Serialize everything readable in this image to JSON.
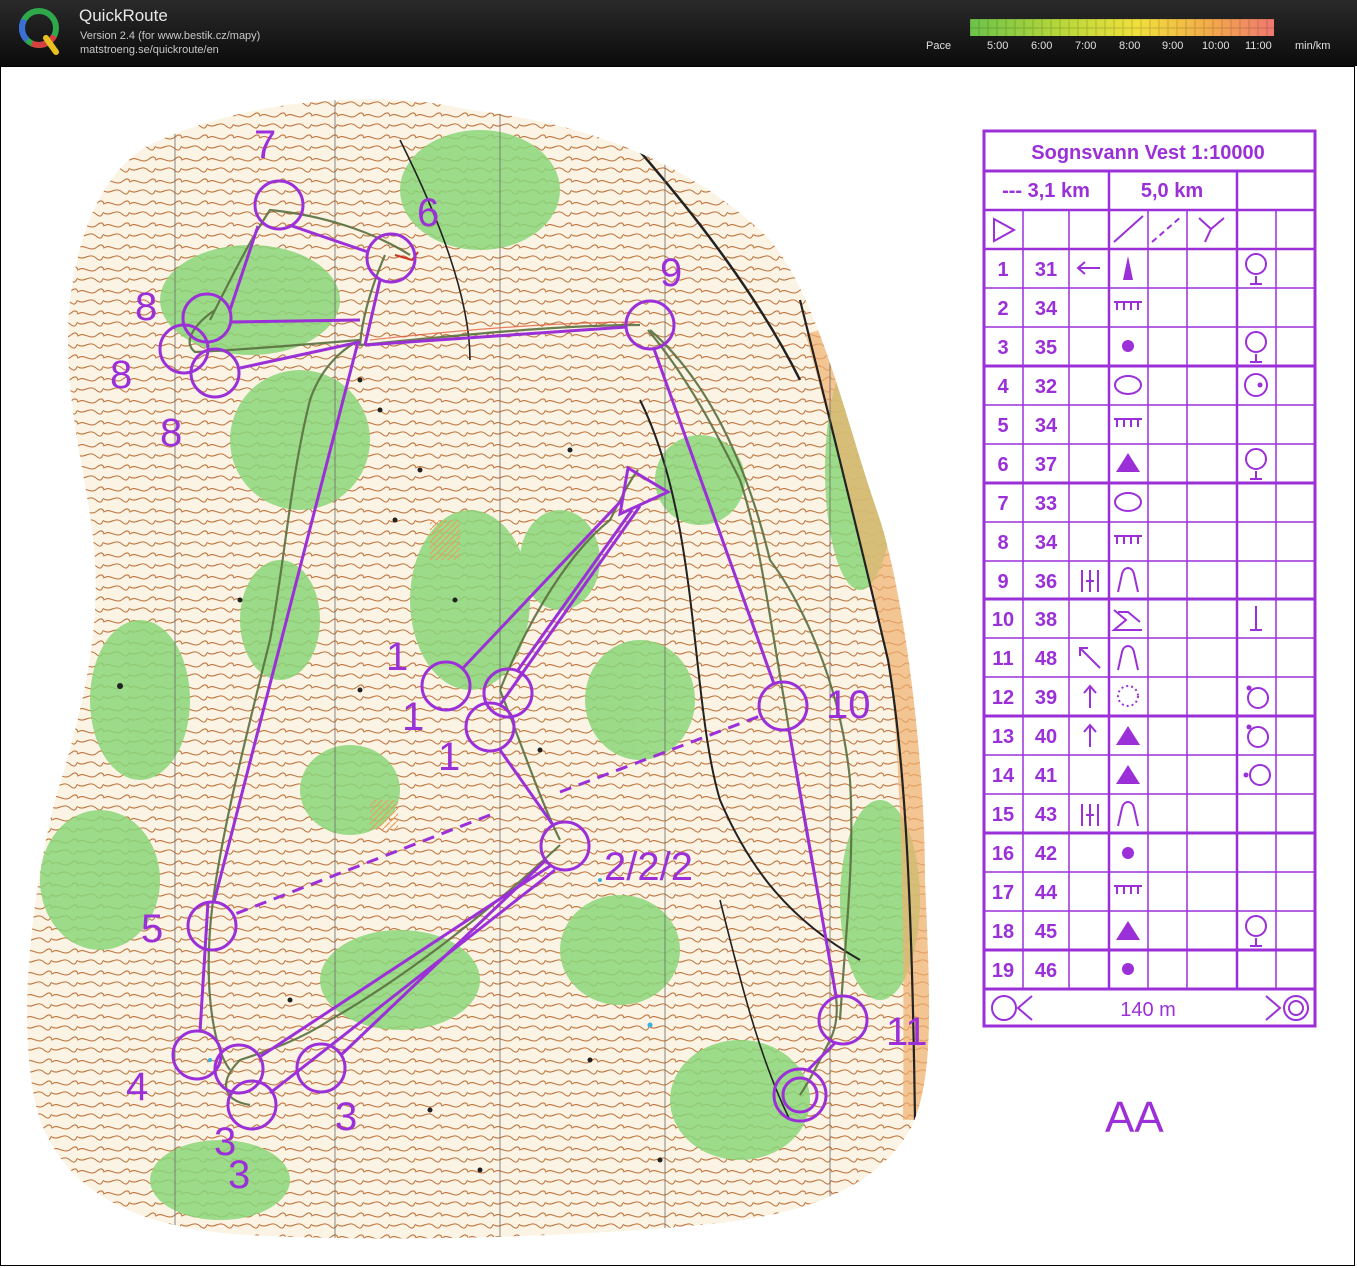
{
  "app": {
    "title": "QuickRoute",
    "version": "Version 2.4  (for www.bestik.cz/mapy)",
    "url": "matstroeng.se/quickroute/en"
  },
  "pace_scale": {
    "label": "Pace",
    "ticks": [
      "5:00",
      "6:00",
      "7:00",
      "8:00",
      "9:00",
      "10:00",
      "11:00"
    ],
    "unit": "min/km",
    "colors": [
      "#6cc24a",
      "#b8d83a",
      "#f0e03c",
      "#f3a84b",
      "#f07870"
    ]
  },
  "description_sheet": {
    "title": "Sognsvann Vest 1:10000",
    "course_code": "--- 3,1 km",
    "length": "5,0 km",
    "controls": [
      {
        "num": "1",
        "code": "31"
      },
      {
        "num": "2",
        "code": "34"
      },
      {
        "num": "3",
        "code": "35"
      },
      {
        "num": "4",
        "code": "32"
      },
      {
        "num": "5",
        "code": "34"
      },
      {
        "num": "6",
        "code": "37"
      },
      {
        "num": "7",
        "code": "33"
      },
      {
        "num": "8",
        "code": "34"
      },
      {
        "num": "9",
        "code": "36"
      },
      {
        "num": "10",
        "code": "38"
      },
      {
        "num": "11",
        "code": "48"
      },
      {
        "num": "12",
        "code": "39"
      },
      {
        "num": "13",
        "code": "40"
      },
      {
        "num": "14",
        "code": "41"
      },
      {
        "num": "15",
        "code": "43"
      },
      {
        "num": "16",
        "code": "42"
      },
      {
        "num": "17",
        "code": "44"
      },
      {
        "num": "18",
        "code": "45"
      },
      {
        "num": "19",
        "code": "46"
      }
    ],
    "finish_distance": "140 m"
  },
  "map_labels": {
    "class": "AA",
    "controls": [
      "7",
      "6",
      "8",
      "8",
      "8",
      "9",
      "1",
      "1",
      "1",
      "10",
      "2/2/2",
      "5",
      "4",
      "3",
      "3",
      "3",
      "11"
    ]
  },
  "colors": {
    "course_purple": "#9b30d9",
    "forest_green": "#8ad67a",
    "contour_brown": "#b8652a",
    "route_line": "#5a7040"
  }
}
